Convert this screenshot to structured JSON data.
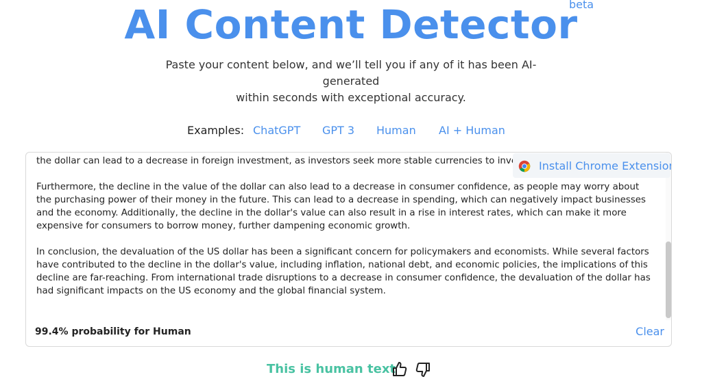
{
  "header": {
    "title": "AI Content Detector",
    "beta_label": "beta",
    "subtitle_line1": "Paste your content below, and we’ll tell you if any of it has been AI-generated",
    "subtitle_line2": "within seconds with exceptional accuracy."
  },
  "examples": {
    "label": "Examples:",
    "items": [
      "ChatGPT",
      "GPT 3",
      "Human",
      "AI + Human"
    ]
  },
  "chrome_extension": {
    "label": "Install Chrome Extension",
    "icon": "chrome-icon"
  },
  "content": {
    "paragraphs": [
      "the dollar can lead to a decrease in foreign investment, as investors seek more stable currencies to invest in. the US economy.",
      "Furthermore, the decline in the value of the dollar can also lead to a decrease in consumer confidence, as people may worry about the purchasing power of their money in the future. This can lead to a decrease in spending, which can negatively impact businesses and the economy. Additionally, the decline in the dollar's value can also result in a rise in interest rates, which can make it more expensive for consumers to borrow money, further dampening economic growth.",
      "In conclusion, the devaluation of the US dollar has been a significant concern for policymakers and economists. While several factors have contributed to the decline in the dollar's value, including inflation, national debt, and economic policies, the implications of this decline are far-reaching. From international trade disruptions to a decrease in consumer confidence, the devaluation of the dollar has had significant impacts on the US economy and the global financial system."
    ]
  },
  "result": {
    "probability_text": "99.4% probability for Human",
    "clear_label": "Clear",
    "verdict": "This is human text",
    "verdict_color": "#49c2a2"
  },
  "colors": {
    "accent": "#4a90ec"
  }
}
